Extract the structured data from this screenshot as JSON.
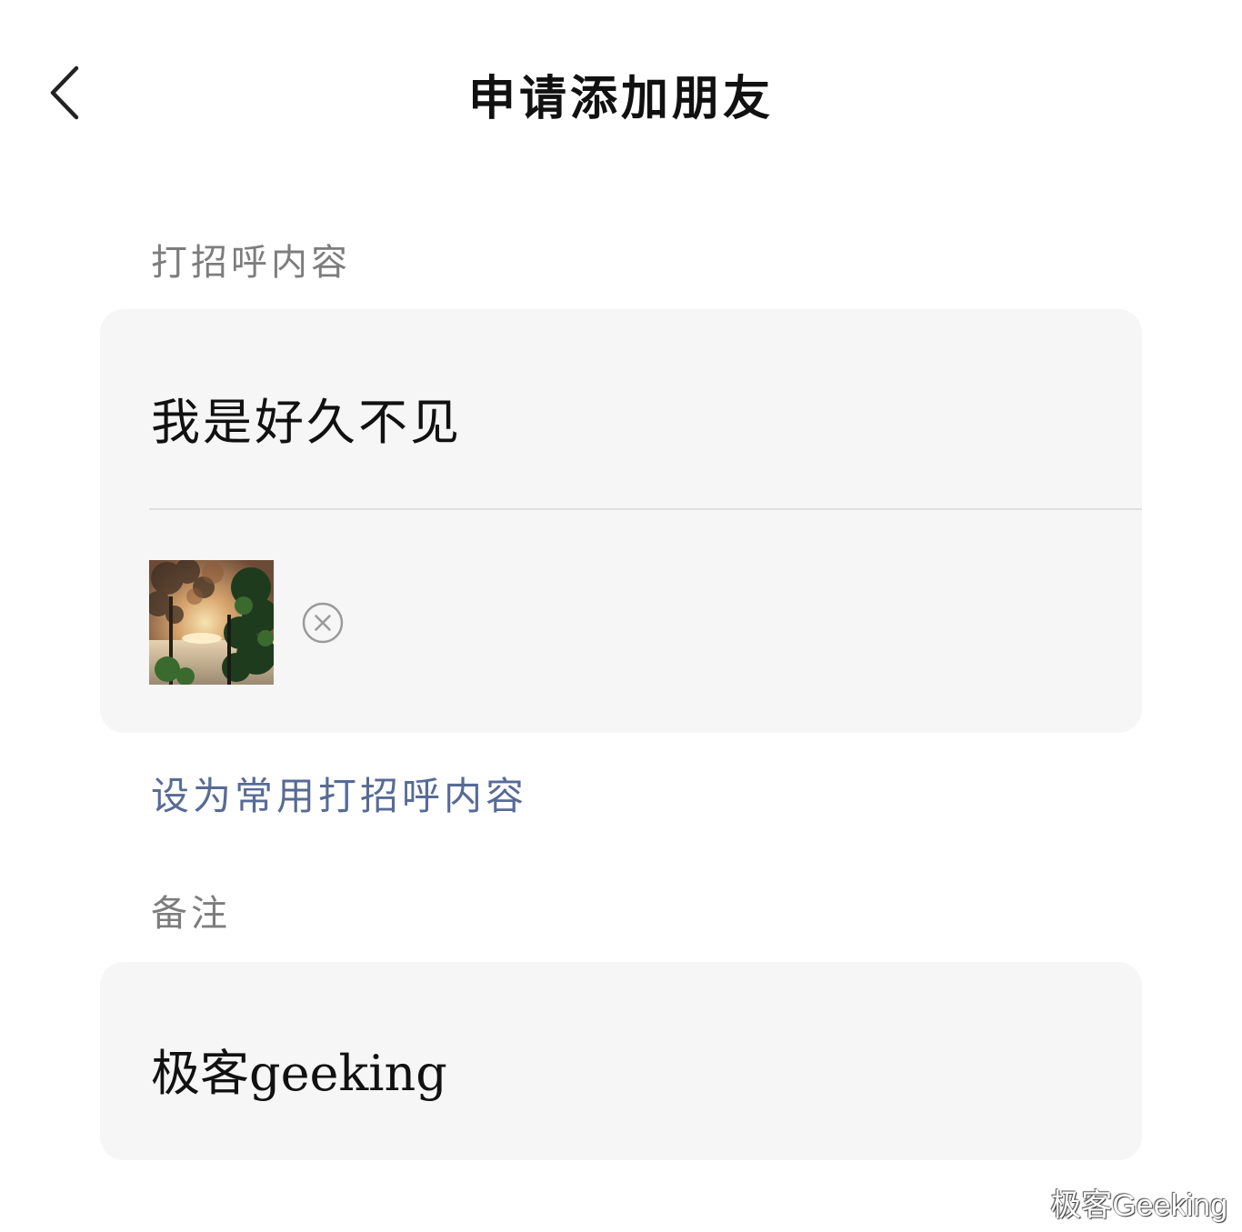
{
  "header": {
    "title": "申请添加朋友",
    "back_icon": "chevron-left-icon"
  },
  "greeting": {
    "label": "打招呼内容",
    "value": "我是好久不见",
    "remove_icon": "close-circle-icon",
    "set_common_label": "设为常用打招呼内容"
  },
  "remark": {
    "label": "备注",
    "value": "极客geeking"
  },
  "watermark": {
    "text": "极客Geeking"
  },
  "colors": {
    "link": "#576b95",
    "card_bg": "#f6f6f6",
    "label": "#7d7d7d"
  }
}
